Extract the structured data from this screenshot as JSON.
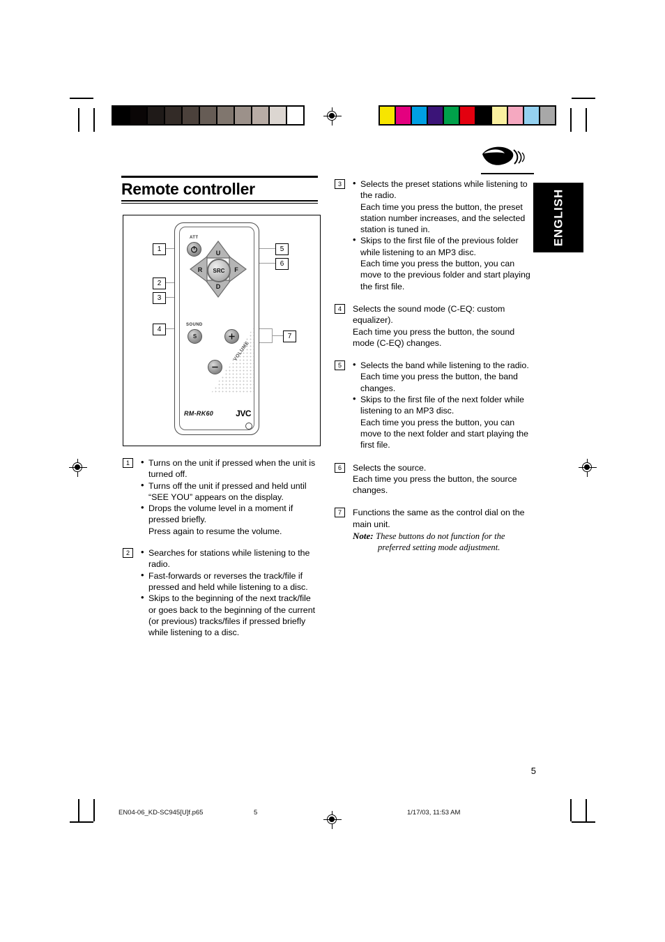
{
  "document": {
    "section_title": "Remote controller",
    "language_tab": "ENGLISH",
    "page_number": "5"
  },
  "figure": {
    "model_name": "RM-RK60",
    "brand": "JVC",
    "labels": {
      "att": "ATT",
      "sound": "SOUND",
      "volume": "VOLUME",
      "up": "U",
      "down": "D",
      "rew": "R",
      "fwd": "F",
      "source": "SRC",
      "sound_btn": "S",
      "vol_up": "+",
      "vol_down": "–"
    },
    "callouts": [
      "1",
      "2",
      "3",
      "4",
      "5",
      "6",
      "7"
    ]
  },
  "items": {
    "one": {
      "num": "1",
      "bullets": [
        "Turns on the unit if pressed when the unit is turned off.",
        "Turns off the unit if pressed and held until “SEE YOU” appears on the display.",
        "Drops the volume level in a moment if pressed briefly."
      ],
      "extra": "Press again to resume the volume."
    },
    "two": {
      "num": "2",
      "bullets": [
        "Searches for stations while listening to the radio.",
        "Fast-forwards or reverses the track/file if pressed and held while listening to a disc.",
        "Skips to the beginning of the next track/file or goes back to the beginning of the current (or previous) tracks/files if pressed briefly while listening to a disc."
      ]
    },
    "three": {
      "num": "3",
      "bullets": [
        "Selects the preset stations while listening to the radio.",
        "Skips to the first file of the previous folder while listening to an MP3 disc."
      ],
      "sub": [
        "Each time you press the button, the preset station number increases, and the selected station is tuned in.",
        "Each time you press the button, you can move to the previous folder and start playing the first file."
      ]
    },
    "four": {
      "num": "4",
      "line1": "Selects the sound mode (C-EQ: custom equalizer).",
      "line2": "Each time you press the button, the sound mode (C-EQ) changes."
    },
    "five": {
      "num": "5",
      "bullets": [
        "Selects the band while listening to the radio.",
        "Skips to the first file of the next folder while listening to an MP3 disc."
      ],
      "sub": [
        "Each time you press the button, the band changes.",
        "Each time you press the button, you can move to the next folder and start playing the first file."
      ]
    },
    "six": {
      "num": "6",
      "line1": "Selects the source.",
      "line2": "Each time you press the button, the source changes."
    },
    "seven": {
      "num": "7",
      "line1": "Functions the same as the control dial on the main unit.",
      "note_label": "Note:",
      "note_line1": "These buttons do not function for the",
      "note_line2": "preferred setting mode adjustment."
    }
  },
  "footer": {
    "filename": "EN04-06_KD-SC945[U]f.p65",
    "page": "5",
    "timestamp": "1/17/03, 11:53 AM"
  },
  "calibration": {
    "grayscale": [
      "#000000",
      "#0a0606",
      "#1f1a18",
      "#332b27",
      "#4b413b",
      "#665c55",
      "#80766e",
      "#9c918a",
      "#b8aca5",
      "#dcd6d1",
      "#ffffff"
    ],
    "colors": [
      "#f7e500",
      "#e4007f",
      "#009fe3",
      "#3b1478",
      "#00a04a",
      "#e3000f",
      "#000000",
      "#faf0a0",
      "#f5a8c0",
      "#94d1f0",
      "#a8a8a8"
    ]
  }
}
